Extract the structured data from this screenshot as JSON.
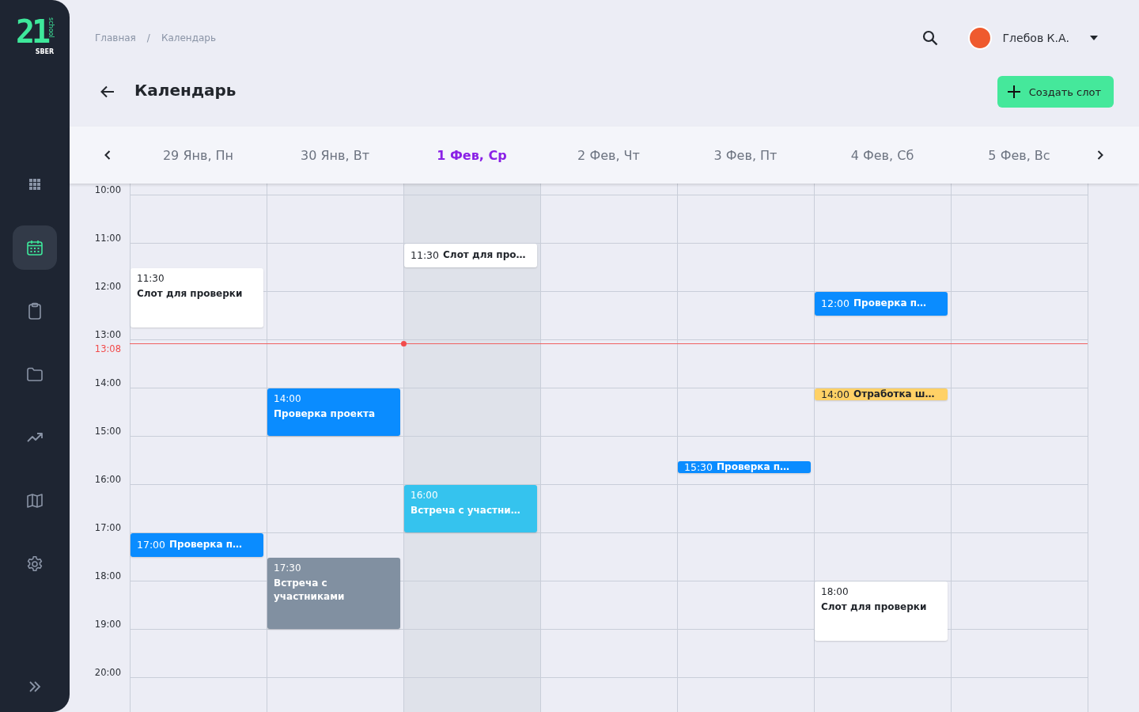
{
  "logo": {
    "mark": "21",
    "vertical": "school",
    "caption": "SBER"
  },
  "sidebar": {
    "items": [
      {
        "kind": "apps",
        "selected": false
      },
      {
        "kind": "calendar",
        "selected": true
      },
      {
        "kind": "clipboard",
        "selected": false
      },
      {
        "kind": "folder",
        "selected": false
      },
      {
        "kind": "trend",
        "selected": false
      },
      {
        "kind": "map",
        "selected": false
      },
      {
        "kind": "settings",
        "selected": false
      }
    ]
  },
  "breadcrumbs": [
    "Главная",
    "/",
    "Календарь"
  ],
  "user": {
    "name": "Глебов К.А."
  },
  "title": "Календарь",
  "create_button": "Создать слот",
  "days": [
    {
      "label": "29 Янв, Пн",
      "selected": false,
      "events": [
        {
          "kind": "block",
          "time": "11:30",
          "title": "Слот для проверки",
          "color": "#ffffff"
        },
        {
          "kind": "inline",
          "time": "17:00",
          "title": "Проверка п…",
          "color": "#0a8cff"
        }
      ]
    },
    {
      "label": "30 Янв, Вт",
      "selected": false,
      "events": [
        {
          "kind": "block",
          "time": "14:00",
          "title": "Проверка проекта",
          "color": "#0a8cff"
        },
        {
          "kind": "block",
          "time": "17:30",
          "title": "Встреча с участниками",
          "color": "#8190a1"
        }
      ]
    },
    {
      "label": "1 Фев, Ср",
      "selected": true,
      "events": [
        {
          "kind": "inline",
          "time": "11:30",
          "title": "Слот для про…",
          "color": "#ffffff"
        },
        {
          "kind": "block",
          "time": "16:00",
          "title": "Встреча с участни…",
          "color": "#35c3ee"
        }
      ]
    },
    {
      "label": "2 Фев, Чт",
      "selected": false
    },
    {
      "label": "3 Фев, Пт",
      "selected": false,
      "events": [
        {
          "kind": "inline",
          "time": "15:30",
          "title": "Проверка п…",
          "color": "#0a8cff"
        }
      ]
    },
    {
      "label": "4 Фев, Сб",
      "selected": false,
      "events": [
        {
          "kind": "inline",
          "time": "12:00",
          "title": "Проверка п…",
          "color": "#0a8cff"
        },
        {
          "kind": "inline",
          "time": "14:00",
          "title": "Отработка ш…",
          "color": "#ffd166"
        },
        {
          "kind": "block",
          "time": "18:00",
          "title": "Слот для проверки",
          "color": "#ffffff"
        }
      ]
    },
    {
      "label": "5 Фев, Вс",
      "selected": false
    }
  ],
  "hours": [
    "10:00",
    "11:00",
    "12:00",
    "13:00",
    "14:00",
    "15:00",
    "16:00",
    "17:00",
    "18:00",
    "19:00",
    "20:00"
  ],
  "now": {
    "label": "13:08"
  }
}
